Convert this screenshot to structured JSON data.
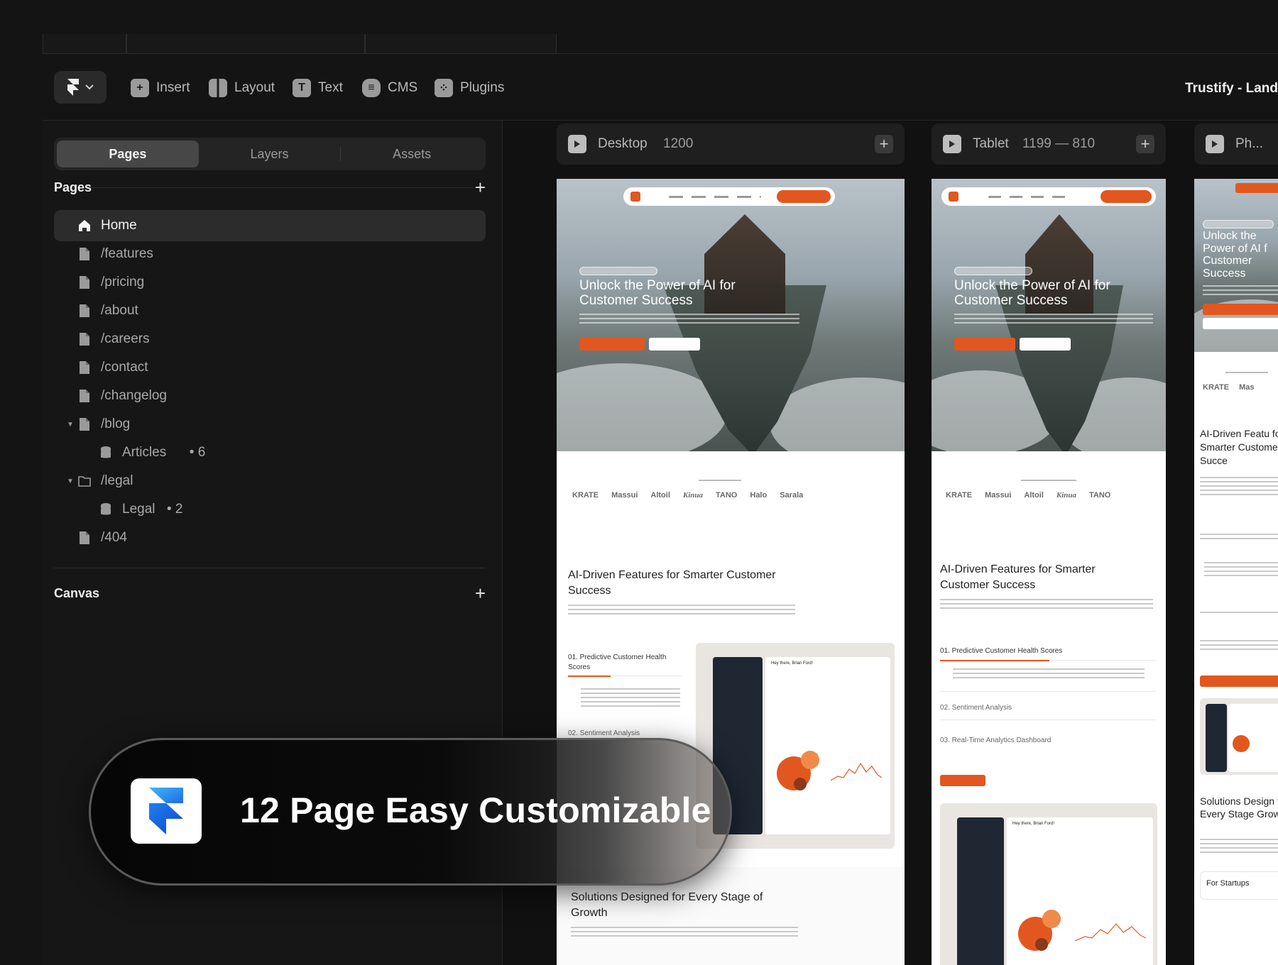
{
  "toolbar": {
    "tools": [
      {
        "label": "Insert",
        "icon": "plus-square-icon"
      },
      {
        "label": "Layout",
        "icon": "layout-icon"
      },
      {
        "label": "Text",
        "icon": "text-icon"
      },
      {
        "label": "CMS",
        "icon": "database-icon"
      },
      {
        "label": "Plugins",
        "icon": "plugins-icon"
      }
    ],
    "project_title": "Trustify - Land"
  },
  "sidebar": {
    "tabs": [
      "Pages",
      "Layers",
      "Assets"
    ],
    "active_tab": "Pages",
    "pages_heading": "Pages",
    "pages": [
      {
        "label": "Home",
        "icon": "home-icon",
        "active": true
      },
      {
        "label": "/features",
        "icon": "page-icon"
      },
      {
        "label": "/pricing",
        "icon": "page-icon"
      },
      {
        "label": "/about",
        "icon": "page-icon"
      },
      {
        "label": "/careers",
        "icon": "page-icon"
      },
      {
        "label": "/contact",
        "icon": "page-icon"
      },
      {
        "label": "/changelog",
        "icon": "page-icon"
      },
      {
        "label": "/blog",
        "icon": "page-icon",
        "expanded": true
      },
      {
        "label": "Articles",
        "icon": "cms-collection-icon",
        "count": "6"
      },
      {
        "label": "/legal",
        "icon": "folder-icon",
        "expanded": true
      },
      {
        "label": "Legal",
        "icon": "cms-collection-icon",
        "count": "2"
      },
      {
        "label": "/404",
        "icon": "page-icon"
      }
    ],
    "canvas_heading": "Canvas"
  },
  "canvas": {
    "frames": [
      {
        "name": "Desktop",
        "dims": "1200"
      },
      {
        "name": "Tablet",
        "dims": "1199 — 810"
      },
      {
        "name": "Ph..."
      }
    ],
    "preview": {
      "hero_title": "Unlock the Power of AI for Customer Success",
      "phone_hero_title": "Unlock the Power of AI f Customer Success",
      "logos": [
        "KRATE",
        "Massui",
        "Altoil",
        "Kinua",
        "TANO",
        "Halo",
        "Sarala"
      ],
      "phone_logos": [
        "KRATE",
        "Mas"
      ],
      "features_title": "AI-Driven Features for Smarter Customer Success",
      "phone_features_title": "AI-Driven Featu for Smarter Customer Succe",
      "feature_1": "01. Predictive Customer Health Scores",
      "feature_2": "02. Sentiment Analysis",
      "feature_3": "03. Real-Time Analytics Dashboard",
      "dashboard_greeting": "Hey there, Brian Ford!",
      "solutions_title": "Solutions Designed for Every Stage of Growth",
      "phone_solutions_title": "Solutions Design for Every Stage Growth",
      "phone_for_startups": "For Startups"
    }
  },
  "promo": {
    "text": "12 Page Easy Customizable",
    "icon": "framer-logo-icon"
  },
  "colors": {
    "accent": "#E2571F",
    "bg": "#141414"
  }
}
